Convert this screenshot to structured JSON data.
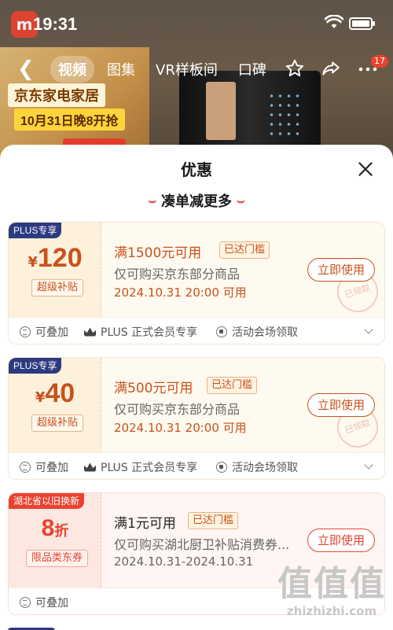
{
  "status_bar": {
    "time": "19:31"
  },
  "nav": {
    "tabs": [
      "视频",
      "图集",
      "VR样板间",
      "口碑"
    ],
    "active_tab": 0,
    "message_badge": "17"
  },
  "background": {
    "promo_line1": "京东家电家居",
    "promo_line2": "10月31日晚8开抢"
  },
  "sheet": {
    "title": "优惠",
    "subtitle": "凑单减更多"
  },
  "coupons": [
    {
      "tag": "PLUS专享",
      "currency": "¥",
      "amount": "120",
      "sublabel": "超级补贴",
      "condition": "满1500元可用",
      "reach_badge": "已达门槛",
      "description": "仅可购买京东部分商品",
      "validity": "2024.10.31 20:00 可用",
      "button": "立即使用",
      "stamp": "已领取",
      "footer": [
        "可叠加",
        "PLUS 正式会员专享",
        "活动会场领取"
      ]
    },
    {
      "tag": "PLUS专享",
      "currency": "¥",
      "amount": "40",
      "sublabel": "超级补贴",
      "condition": "满500元可用",
      "reach_badge": "已达门槛",
      "description": "仅可购买京东部分商品",
      "validity": "2024.10.31 20:00 可用",
      "button": "立即使用",
      "stamp": "已领取",
      "footer": [
        "可叠加",
        "PLUS 正式会员专享",
        "活动会场领取"
      ]
    },
    {
      "tag": "湖北省以旧换新",
      "amount": "8",
      "unit": "折",
      "sublabel": "限品类东券",
      "condition": "满1元可用",
      "reach_badge": "已达门槛",
      "description": "仅可购买湖北厨卫补贴消费券...",
      "validity": "2024.10.31-2024.10.31",
      "button": "立即使用",
      "footer": [
        "可叠加"
      ]
    }
  ],
  "watermark": {
    "logo": "值值值",
    "url": "zhizhizhi.com"
  },
  "colors": {
    "accent": "#c8511c",
    "plus_tag": "#2d3a80",
    "red": "#e8432f"
  }
}
